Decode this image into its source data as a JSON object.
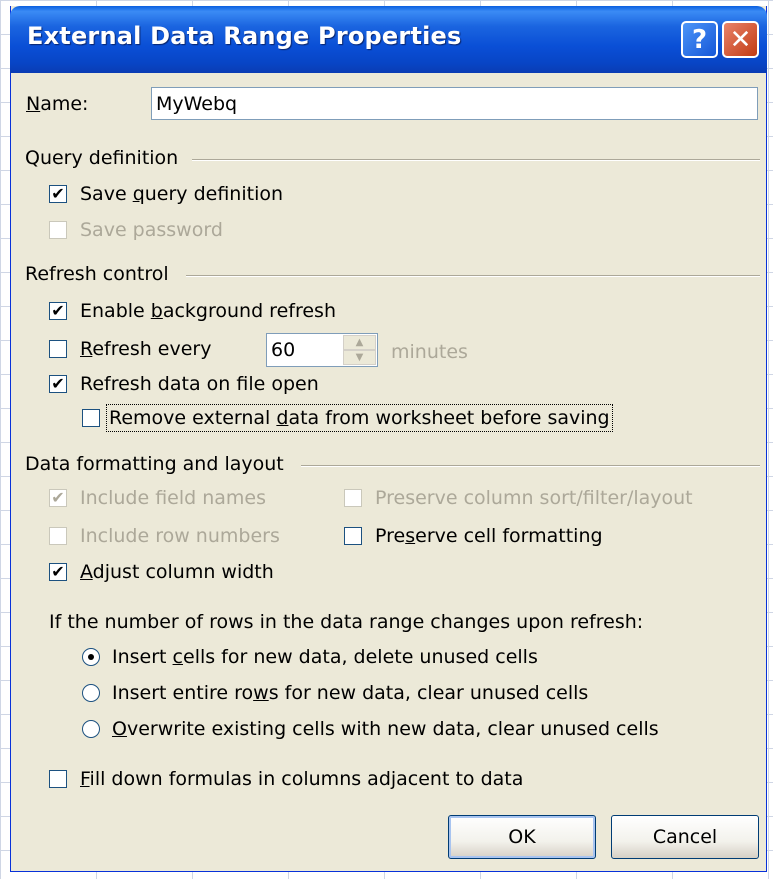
{
  "dialog": {
    "title": "External Data Range Properties",
    "help_glyph": "?",
    "close_glyph": "✕"
  },
  "name": {
    "label_first": "N",
    "label_rest": "ame:",
    "value": "MyWebq"
  },
  "query_definition": {
    "title": "Query definition",
    "save_query": {
      "pre": "Save ",
      "key": "q",
      "post": "uery definition",
      "checked": true
    },
    "save_password": {
      "label": "Save password",
      "checked": false,
      "disabled": true
    }
  },
  "refresh_control": {
    "title": "Refresh control",
    "background_refresh": {
      "pre": "Enable ",
      "key": "b",
      "post": "ackground refresh",
      "checked": true
    },
    "refresh_every": {
      "pre": "",
      "key": "R",
      "post": "efresh every",
      "checked": false,
      "value": "60",
      "unit": "minutes"
    },
    "refresh_on_open": {
      "pre": "Refresh data on f",
      "key": "i",
      "post": "le open",
      "checked": true
    },
    "remove_external": {
      "pre": "Remove external ",
      "key": "d",
      "post": "ata from worksheet before saving",
      "checked": false
    }
  },
  "formatting": {
    "title": "Data formatting and layout",
    "include_field_names": {
      "label": "Include field names",
      "checked": true,
      "disabled": true
    },
    "include_row_numbers": {
      "label": "Include row numbers",
      "checked": false,
      "disabled": true
    },
    "adjust_column_width": {
      "pre": "",
      "key": "A",
      "post": "djust column width",
      "checked": true
    },
    "preserve_sort": {
      "label": "Preserve column sort/filter/layout",
      "checked": false,
      "disabled": true
    },
    "preserve_cell": {
      "pre": "Pre",
      "key": "s",
      "post": "erve cell formatting",
      "checked": false
    }
  },
  "rows_change": {
    "prompt": "If the number of rows in the data range changes upon refresh:",
    "options": [
      {
        "pre": "Insert ",
        "key": "c",
        "post": "ells for new data, delete unused cells",
        "selected": true
      },
      {
        "pre": "Insert entire ro",
        "key": "w",
        "post": "s for new data, clear unused cells",
        "selected": false
      },
      {
        "pre": "",
        "key": "O",
        "post": "verwrite existing cells with new data, clear unused cells",
        "selected": false
      }
    ]
  },
  "fill_down": {
    "pre": "",
    "key": "F",
    "post": "ill down formulas in columns adjacent to data",
    "checked": false
  },
  "buttons": {
    "ok": "OK",
    "cancel": "Cancel"
  }
}
